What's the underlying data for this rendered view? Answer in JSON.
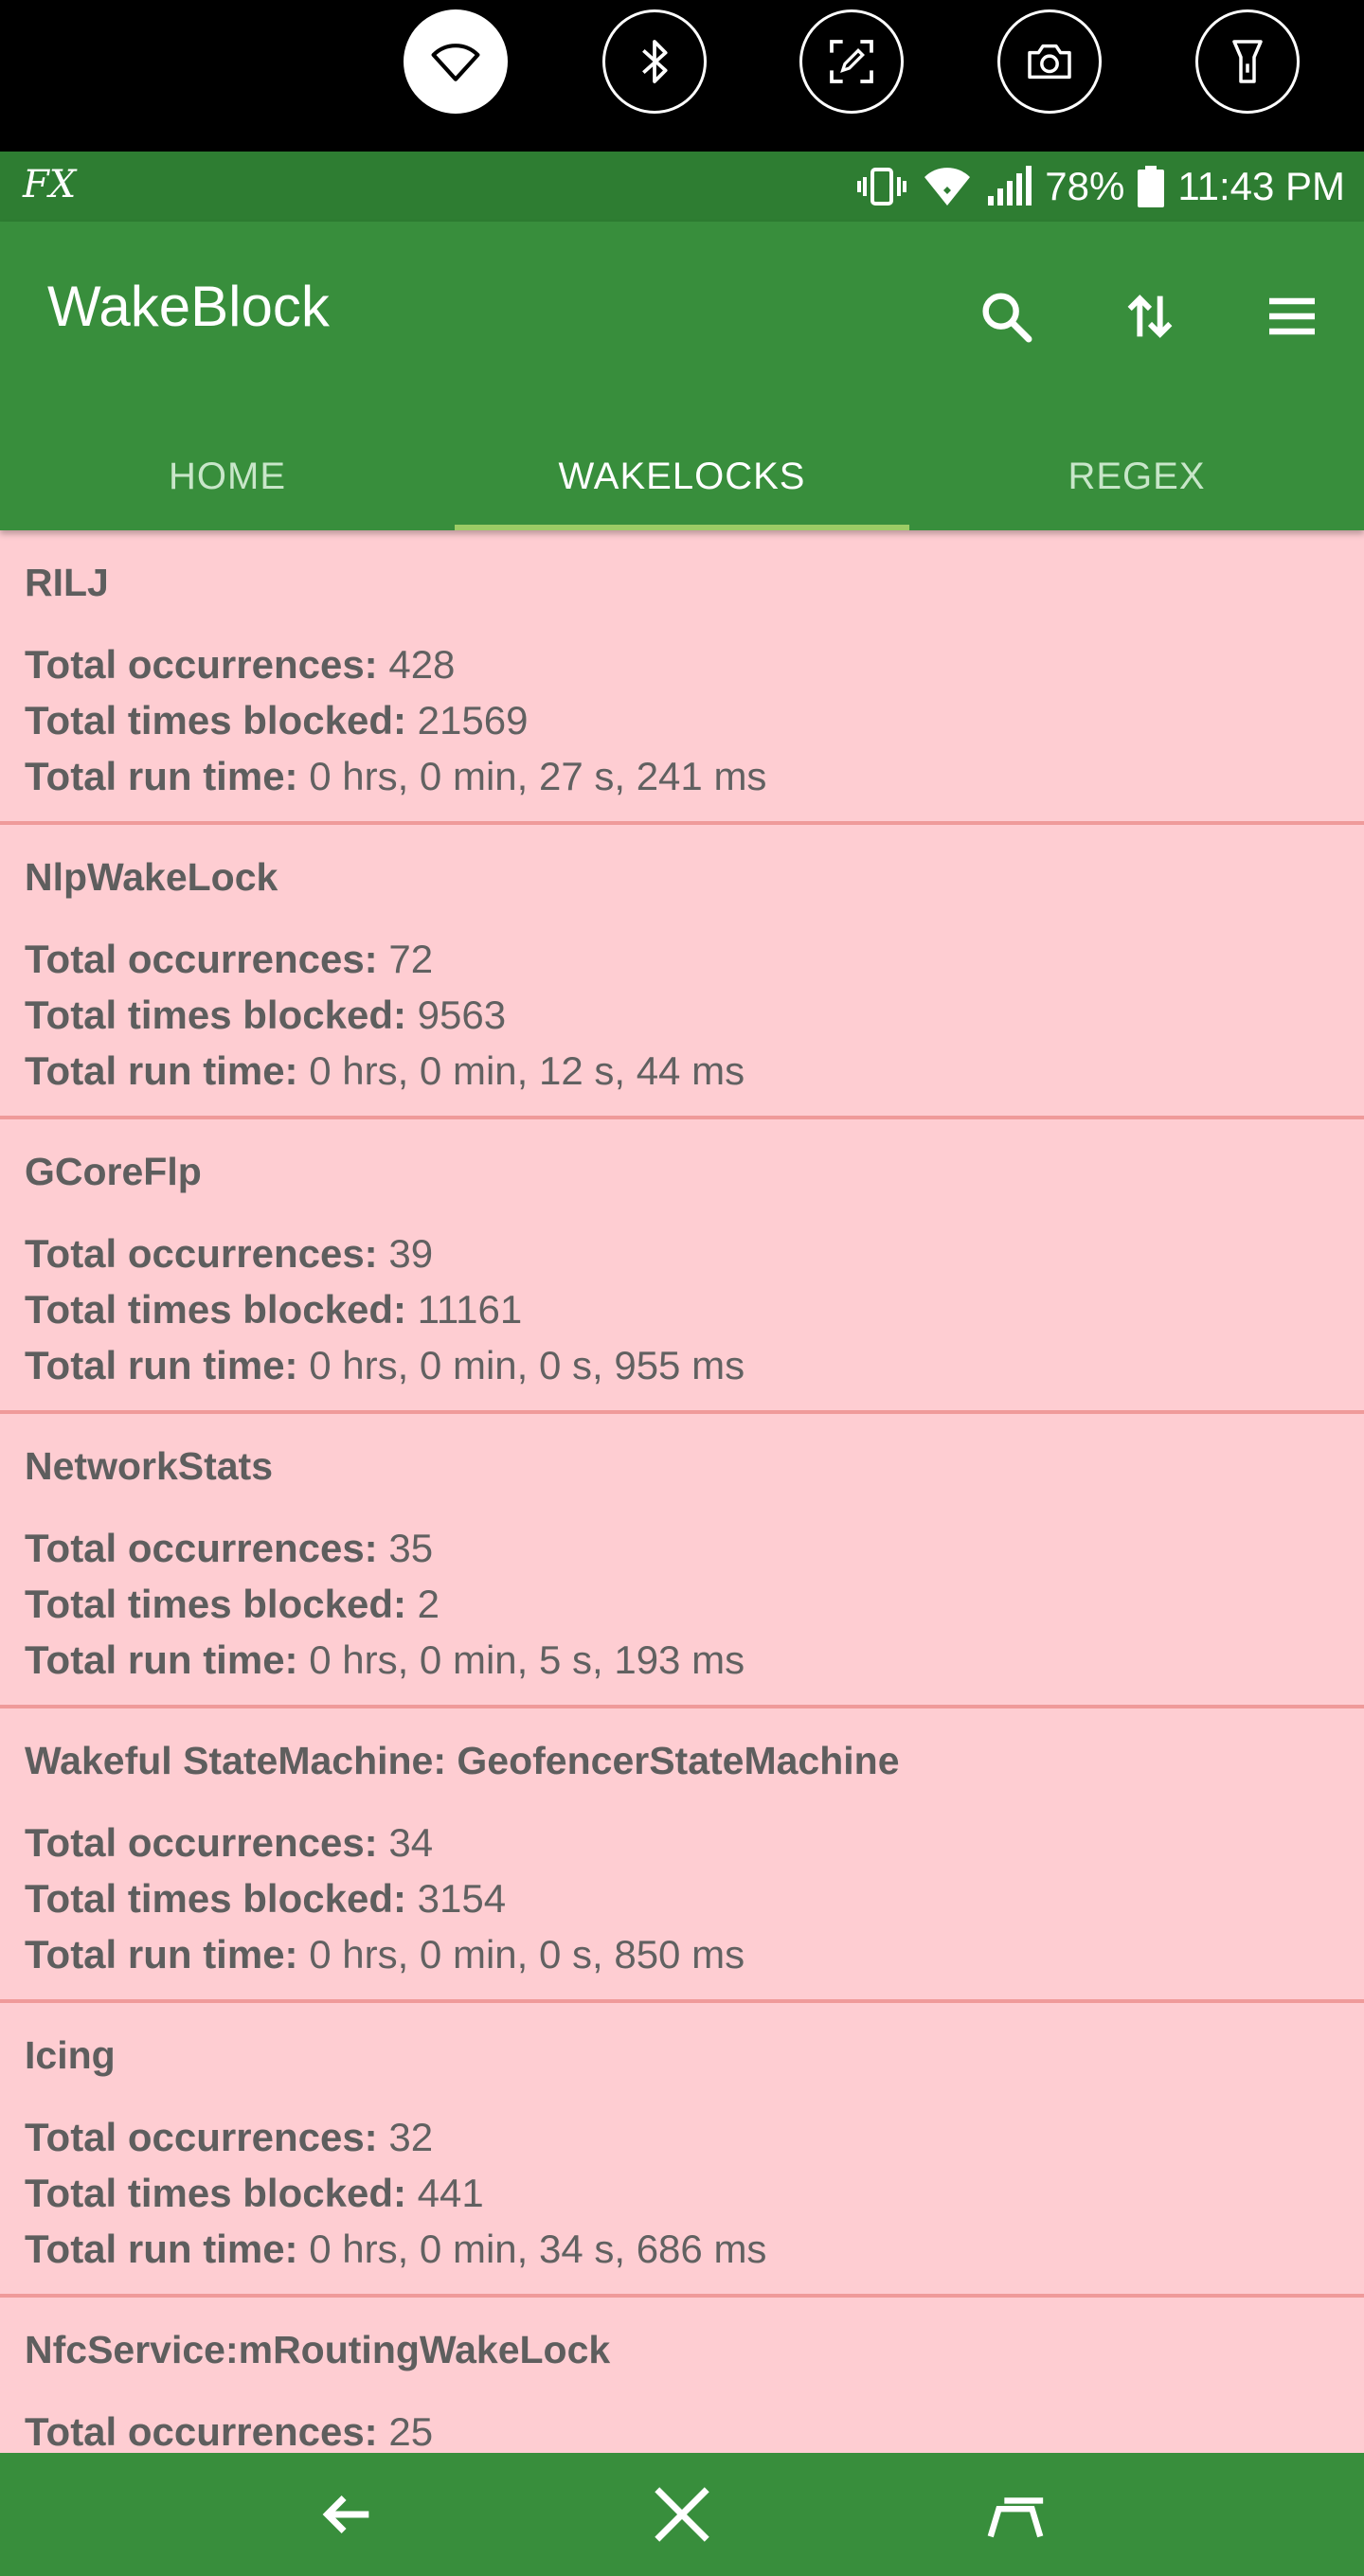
{
  "status_bar": {
    "fx_label": "FX",
    "battery": "78%",
    "time": "11:43 PM"
  },
  "app": {
    "title": "WakeBlock",
    "tabs": [
      "HOME",
      "WAKELOCKS",
      "REGEX"
    ]
  },
  "labels": {
    "occurrences": "Total occurrences:",
    "blocked": "Total times blocked:",
    "runtime": "Total run time:"
  },
  "wakelocks": [
    {
      "name": "RILJ",
      "occurrences": "428",
      "blocked": "21569",
      "runtime": "0 hrs, 0 min, 27 s, 241 ms"
    },
    {
      "name": "NlpWakeLock",
      "occurrences": "72",
      "blocked": "9563",
      "runtime": "0 hrs, 0 min, 12 s, 44 ms"
    },
    {
      "name": "GCoreFlp",
      "occurrences": "39",
      "blocked": "11161",
      "runtime": "0 hrs, 0 min, 0 s, 955 ms"
    },
    {
      "name": "NetworkStats",
      "occurrences": "35",
      "blocked": "2",
      "runtime": "0 hrs, 0 min, 5 s, 193 ms"
    },
    {
      "name": "Wakeful StateMachine: GeofencerStateMachine",
      "occurrences": "34",
      "blocked": "3154",
      "runtime": "0 hrs, 0 min, 0 s, 850 ms"
    },
    {
      "name": "Icing",
      "occurrences": "32",
      "blocked": "441",
      "runtime": "0 hrs, 0 min, 34 s, 686 ms"
    },
    {
      "name": "NfcService:mRoutingWakeLock",
      "occurrences": "25",
      "blocked": "",
      "runtime": ""
    }
  ]
}
